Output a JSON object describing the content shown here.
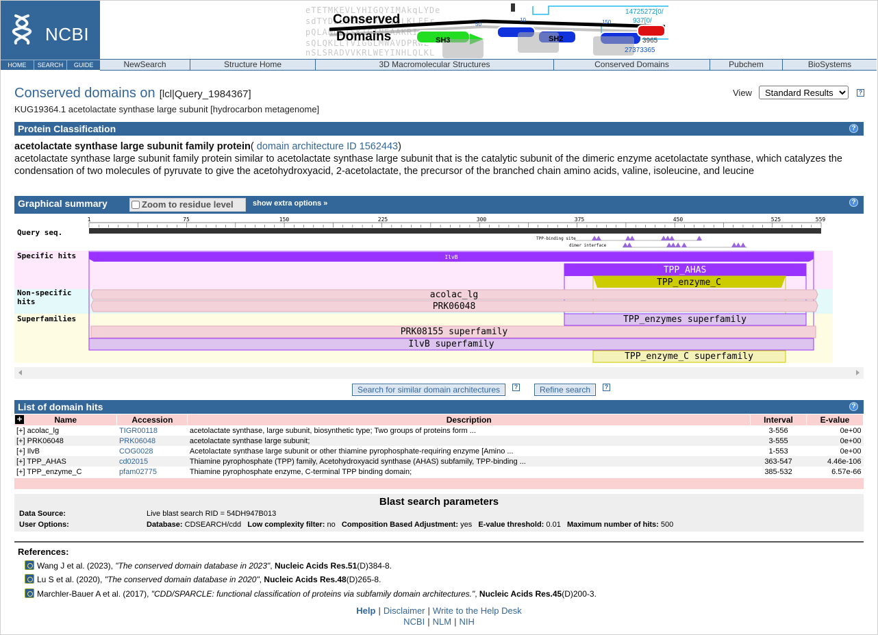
{
  "header": {
    "logo_text": "NCBI",
    "logo_nav": [
      "HOME",
      "SEARCH",
      "GUIDE"
    ],
    "banner_title": "Conserved Domains",
    "banner_labels": [
      "SH3",
      "SH2"
    ],
    "banner_ids": [
      "14725272[0/",
      "937[0/",
      "3965",
      "27373365"
    ],
    "banner_bg_seq": [
      "eTETMKEVLYHIGQYIMAkqLYDe",
      "sdTYDLLNEQHVRERVQLKLFEr",
      "pQLANDLISKIGINEAAKRI",
      "sQLQKLLTVIGGLMWAVDPRWL",
      "nSLSRADVVKRLWEYINHLQLKL"
    ],
    "nav_items": [
      "NewSearch",
      "Structure Home",
      "3D Macromolecular Structures",
      "Conserved Domains",
      "Pubchem",
      "BioSystems"
    ]
  },
  "title": {
    "heading": "Conserved domains on",
    "query_id": "[lcl|Query_1984367]",
    "subtitle": "KUG19364.1 acetolactate synthase large subunit [hydrocarbon metagenome]",
    "view_label": "View",
    "view_selected": "Standard Results"
  },
  "classification": {
    "bar_title": "Protein Classification",
    "family_name": "acetolactate synthase large subunit family protein",
    "open_paren": "( ",
    "arch_link": "domain architecture ID 1562443",
    "close_paren": ")",
    "description": "acetolactate synthase large subunit family protein similar to acetolactate synthase large subunit that is the catalytic subunit of the dimeric enzyme acetolactate synthase, which catalyzes the condensation of two molecules of pyruvate to give the acetohydroxyacid, 2-acetolactate, the precursor of the branched chain amino acids, valine, isoleucine, and leucine"
  },
  "graphical": {
    "bar_title": "Graphical summary",
    "zoom_label": "Zoom to residue level",
    "extra_options": "show extra options »",
    "query_label": "Query seq.",
    "specific_label": "Specific hits",
    "nonspecific_label_1": "Non-specific",
    "nonspecific_label_2": "hits",
    "superfamilies_label": "Superfamilies",
    "ticks": [
      "1",
      "75",
      "150",
      "225",
      "300",
      "375",
      "450",
      "525",
      "559"
    ],
    "site_labels": [
      "TPP-binding site",
      "dimer interface"
    ],
    "hits": {
      "ilvb": "IlvB",
      "tpp_ahas": "TPP_AHAS",
      "tpp_enzyme_c": "TPP_enzyme_C",
      "acolac_lg": "acolac_lg",
      "prk06048": "PRK06048",
      "tpp_enzymes_sf": "TPP_enzymes superfamily",
      "prk08155_sf": "PRK08155 superfamily",
      "ilvb_sf": "IlvB superfamily",
      "tpp_enzyme_c_sf": "TPP_enzyme_C superfamily"
    },
    "colors": {
      "specific_bg": "#fde9fb",
      "nonspecific_bg": "#e4fafa",
      "superfamily_bg": "#fefde4",
      "purple": "#9933ff",
      "olive": "#cccc00",
      "pink_bar": "#f3d2da",
      "lavender": "#dcc4ee",
      "pale_yellow": "#f4f2b8"
    }
  },
  "buttons": {
    "similar_arch": "Search for similar domain architectures",
    "refine": "Refine search"
  },
  "domain_hits": {
    "bar_title": "List of domain hits",
    "columns": [
      "Name",
      "Accession",
      "Description",
      "Interval",
      "E-value"
    ],
    "rows": [
      {
        "expander": "[+]",
        "name": "acolac_lg",
        "accession": "TIGR00118",
        "description": "acetolactate synthase, large subunit, biosynthetic type; Two groups of proteins form ...",
        "interval": "3-556",
        "evalue": "0e+00"
      },
      {
        "expander": "[+]",
        "name": "PRK06048",
        "accession": "PRK06048",
        "description": "acetolactate synthase large subunit;",
        "interval": "3-555",
        "evalue": "0e+00"
      },
      {
        "expander": "[+]",
        "name": "IlvB",
        "accession": "COG0028",
        "description": "Acetolactate synthase large subunit or other thiamine pyrophosphate-requiring enzyme [Amino ...",
        "interval": "1-553",
        "evalue": "0e+00"
      },
      {
        "expander": "[+]",
        "name": "TPP_AHAS",
        "accession": "cd02015",
        "description": "Thiamine pyrophosphate (TPP) family, Acetohydroxyacid synthase (AHAS) subfamily, TPP-binding ...",
        "interval": "363-547",
        "evalue": "4.46e-106"
      },
      {
        "expander": "[+]",
        "name": "TPP_enzyme_C",
        "accession": "pfam02775",
        "description": "Thiamine pyrophosphate enzyme, C-terminal TPP binding domain;",
        "interval": "385-532",
        "evalue": "6.57e-66"
      }
    ]
  },
  "blast": {
    "title": "Blast search parameters",
    "data_source_label": "Data Source:",
    "data_source_value": "Live blast search RID = 54DH947B013",
    "user_options_label": "User Options:",
    "db_label": "Database:",
    "db_value": "CDSEARCH/cdd",
    "lc_label": "Low complexity filter:",
    "lc_value": "no",
    "cba_label": "Composition Based Adjustment:",
    "cba_value": "yes",
    "ev_label": "E-value threshold:",
    "ev_value": "0.01",
    "mh_label": "Maximum number of hits:",
    "mh_value": "500"
  },
  "references": {
    "heading": "References:",
    "items": [
      {
        "authors": "Wang J et al. (2023), ",
        "title": "\"The conserved domain database in 2023\"",
        "journal": "Nucleic Acids Res.",
        "volume": "51",
        "pages": "(D)384-8."
      },
      {
        "authors": "Lu S et al. (2020), ",
        "title": "\"The conserved domain database in 2020\"",
        "journal": "Nucleic Acids Res.",
        "volume": "48",
        "pages": "(D)265-8."
      },
      {
        "authors": "Marchler-Bauer A et al. (2017), ",
        "title": "\"CDD/SPARCLE: functional classification of proteins via subfamily domain architectures.\"",
        "journal": "Nucleic Acids Res.",
        "volume": "45",
        "pages": "(D)200-3."
      }
    ]
  },
  "footer": {
    "help": "Help",
    "disclaimer": "Disclaimer",
    "write": "Write to the Help Desk",
    "ncbi": "NCBI",
    "nlm": "NLM",
    "nih": "NIH",
    "sep": "|"
  }
}
